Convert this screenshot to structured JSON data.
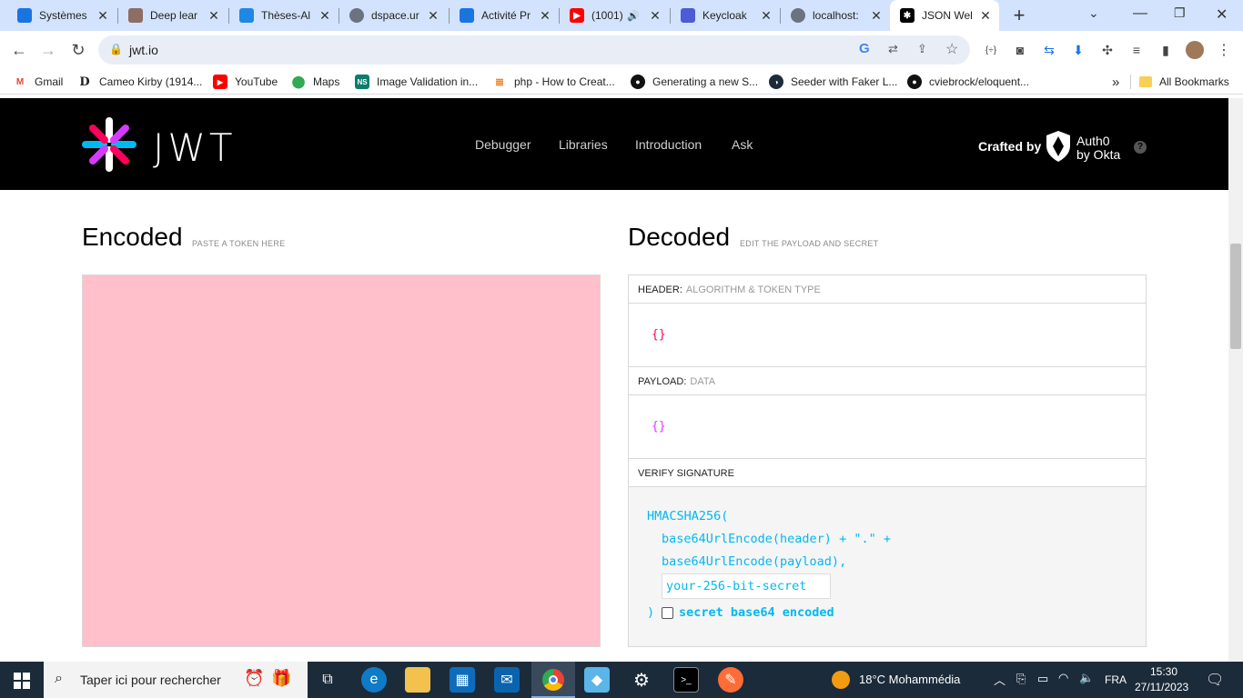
{
  "browser": {
    "tabs": [
      {
        "title": "Systèmes",
        "icon": "person-icon",
        "color": "#1a73e8"
      },
      {
        "title": "Deep lear",
        "icon": "avatar-icon",
        "color": "#8d6e63"
      },
      {
        "title": "Thèses-Al",
        "icon": "flag-icon",
        "color": "#1e88e5"
      },
      {
        "title": "dspace.ur",
        "icon": "globe-icon",
        "color": "#6b7280"
      },
      {
        "title": "Activité Pr",
        "icon": "person-icon",
        "color": "#1a73e8"
      },
      {
        "title": "(1001)",
        "icon": "youtube-icon",
        "color": "#ff0000"
      },
      {
        "title": "Keycloak",
        "icon": "keycloak-icon",
        "color": "#4d5bd6"
      },
      {
        "title": "localhost:",
        "icon": "globe-icon",
        "color": "#6b7280"
      },
      {
        "title": "JSON Wel",
        "icon": "jwt-icon",
        "color": "#000000"
      }
    ],
    "url": "jwt.io",
    "bookmarks": [
      {
        "label": "Gmail",
        "icon": "gmail-icon"
      },
      {
        "label": "Cameo Kirby (1914...",
        "icon": "d-icon"
      },
      {
        "label": "YouTube",
        "icon": "youtube-icon"
      },
      {
        "label": "Maps",
        "icon": "maps-icon"
      },
      {
        "label": "Image Validation in...",
        "icon": "ns-icon"
      },
      {
        "label": "php - How to Creat...",
        "icon": "stackoverflow-icon"
      },
      {
        "label": "Generating a new S...",
        "icon": "github-icon"
      },
      {
        "label": "Seeder with Faker L...",
        "icon": "laracasts-icon"
      },
      {
        "label": "cviebrock/eloquent...",
        "icon": "github-icon"
      }
    ],
    "all_bookmarks": "All Bookmarks"
  },
  "site": {
    "logo": "JWT",
    "nav": [
      "Debugger",
      "Libraries",
      "Introduction",
      "Ask"
    ],
    "crafted_by": "Crafted by",
    "brand_line1": "Auth0",
    "brand_line2": "by Okta",
    "help": "?"
  },
  "encoded": {
    "title": "Encoded",
    "subtitle": "PASTE A TOKEN HERE"
  },
  "decoded": {
    "title": "Decoded",
    "subtitle": "EDIT THE PAYLOAD AND SECRET",
    "header_label": "HEADER:",
    "header_desc": "ALGORITHM & TOKEN TYPE",
    "header_json": "{}",
    "payload_label": "PAYLOAD:",
    "payload_desc": "DATA",
    "payload_json": "{}",
    "verify_label": "VERIFY SIGNATURE",
    "sig_line1": "HMACSHA256(",
    "sig_line2": "base64UrlEncode(header) + \".\" +",
    "sig_line3": "base64UrlEncode(payload),",
    "secret_placeholder": "your-256-bit-secret",
    "sig_close": ")",
    "b64_label": "secret base64 encoded"
  },
  "taskbar": {
    "search_placeholder": "Taper ici pour rechercher",
    "weather": "18°C  Mohammédia",
    "lang": "FRA",
    "time": "15:30",
    "date": "27/11/2023"
  },
  "colors": {
    "encoded_bg": "#ffc0cb",
    "header_json": "#fb015b",
    "payload_json": "#d63aff",
    "signature": "#00b9f1"
  }
}
